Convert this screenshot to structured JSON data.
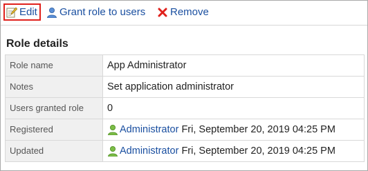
{
  "toolbar": {
    "edit_label": "Edit",
    "grant_label": "Grant role to users",
    "remove_label": "Remove"
  },
  "section": {
    "title": "Role details"
  },
  "rows": [
    {
      "label": "Role name",
      "value": "App Administrator"
    },
    {
      "label": "Notes",
      "value": "Set application administrator"
    },
    {
      "label": "Users granted role",
      "value": "0"
    },
    {
      "label": "Registered",
      "user": "Administrator",
      "date": "Fri, September 20, 2019 04:25 PM"
    },
    {
      "label": "Updated",
      "user": "Administrator",
      "date": "Fri, September 20, 2019 04:25 PM"
    }
  ],
  "colors": {
    "link": "#1a4fa0",
    "edit_highlight": "#e0201b",
    "remove_icon": "#e0201b",
    "label_bg": "#f0f0f0",
    "user_icon": "#6aa83a"
  },
  "icons": {
    "edit": "edit-icon",
    "grant": "user-icon",
    "remove": "remove-x-icon",
    "user": "user-icon"
  }
}
